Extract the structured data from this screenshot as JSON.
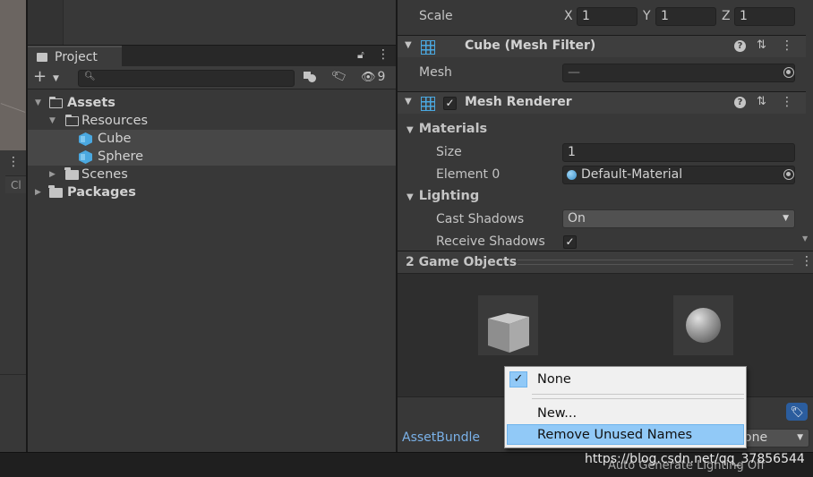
{
  "project_window": {
    "tab_label": "Project",
    "hidden_count": "9",
    "search": {
      "value": "",
      "placeholder": ""
    },
    "tree": [
      {
        "label": "Assets",
        "bold": true
      },
      {
        "label": "Resources",
        "bold": false
      },
      {
        "label": "Cube",
        "bold": false
      },
      {
        "label": "Sphere",
        "bold": false
      },
      {
        "label": "Scenes",
        "bold": false
      },
      {
        "label": "Packages",
        "bold": true
      }
    ]
  },
  "left_strip": {
    "tab_fragment": "Cl"
  },
  "inspector": {
    "scale": {
      "label": "Scale",
      "x_label": "X",
      "x": "1",
      "y_label": "Y",
      "y": "1",
      "z_label": "Z",
      "z": "1"
    },
    "mesh_filter": {
      "title": "Cube (Mesh Filter)",
      "mesh_label": "Mesh",
      "mesh_value": "—"
    },
    "mesh_renderer": {
      "title": "Mesh Renderer",
      "enabled_check": "✓",
      "materials_section": "Materials",
      "size_label": "Size",
      "size_value": "1",
      "element0_label": "Element 0",
      "element0_value": "Default-Material",
      "lighting_section": "Lighting",
      "cast_shadows_label": "Cast Shadows",
      "cast_shadows_value": "On",
      "receive_shadows_label": "Receive Shadows",
      "receive_shadows_check": "✓"
    },
    "help_glyph": "?"
  },
  "preview": {
    "title": "2 Game Objects",
    "assetbundle_label": "AssetBundle",
    "variant_value": "one"
  },
  "popup_menu": {
    "items": [
      {
        "label": "None",
        "checked": true
      },
      {
        "label": "New..."
      },
      {
        "label": "Remove Unused Names",
        "highlighted": true
      }
    ],
    "check_glyph": "✓"
  },
  "status_bar": {
    "text": "Auto Generate Lighting Off"
  },
  "watermark": "https://blog.csdn.net/qq_37856544",
  "colors": {
    "accent_blue": "#4aa8e0",
    "link_blue": "#7ab1e8",
    "menu_highlight": "#91c9f7"
  }
}
